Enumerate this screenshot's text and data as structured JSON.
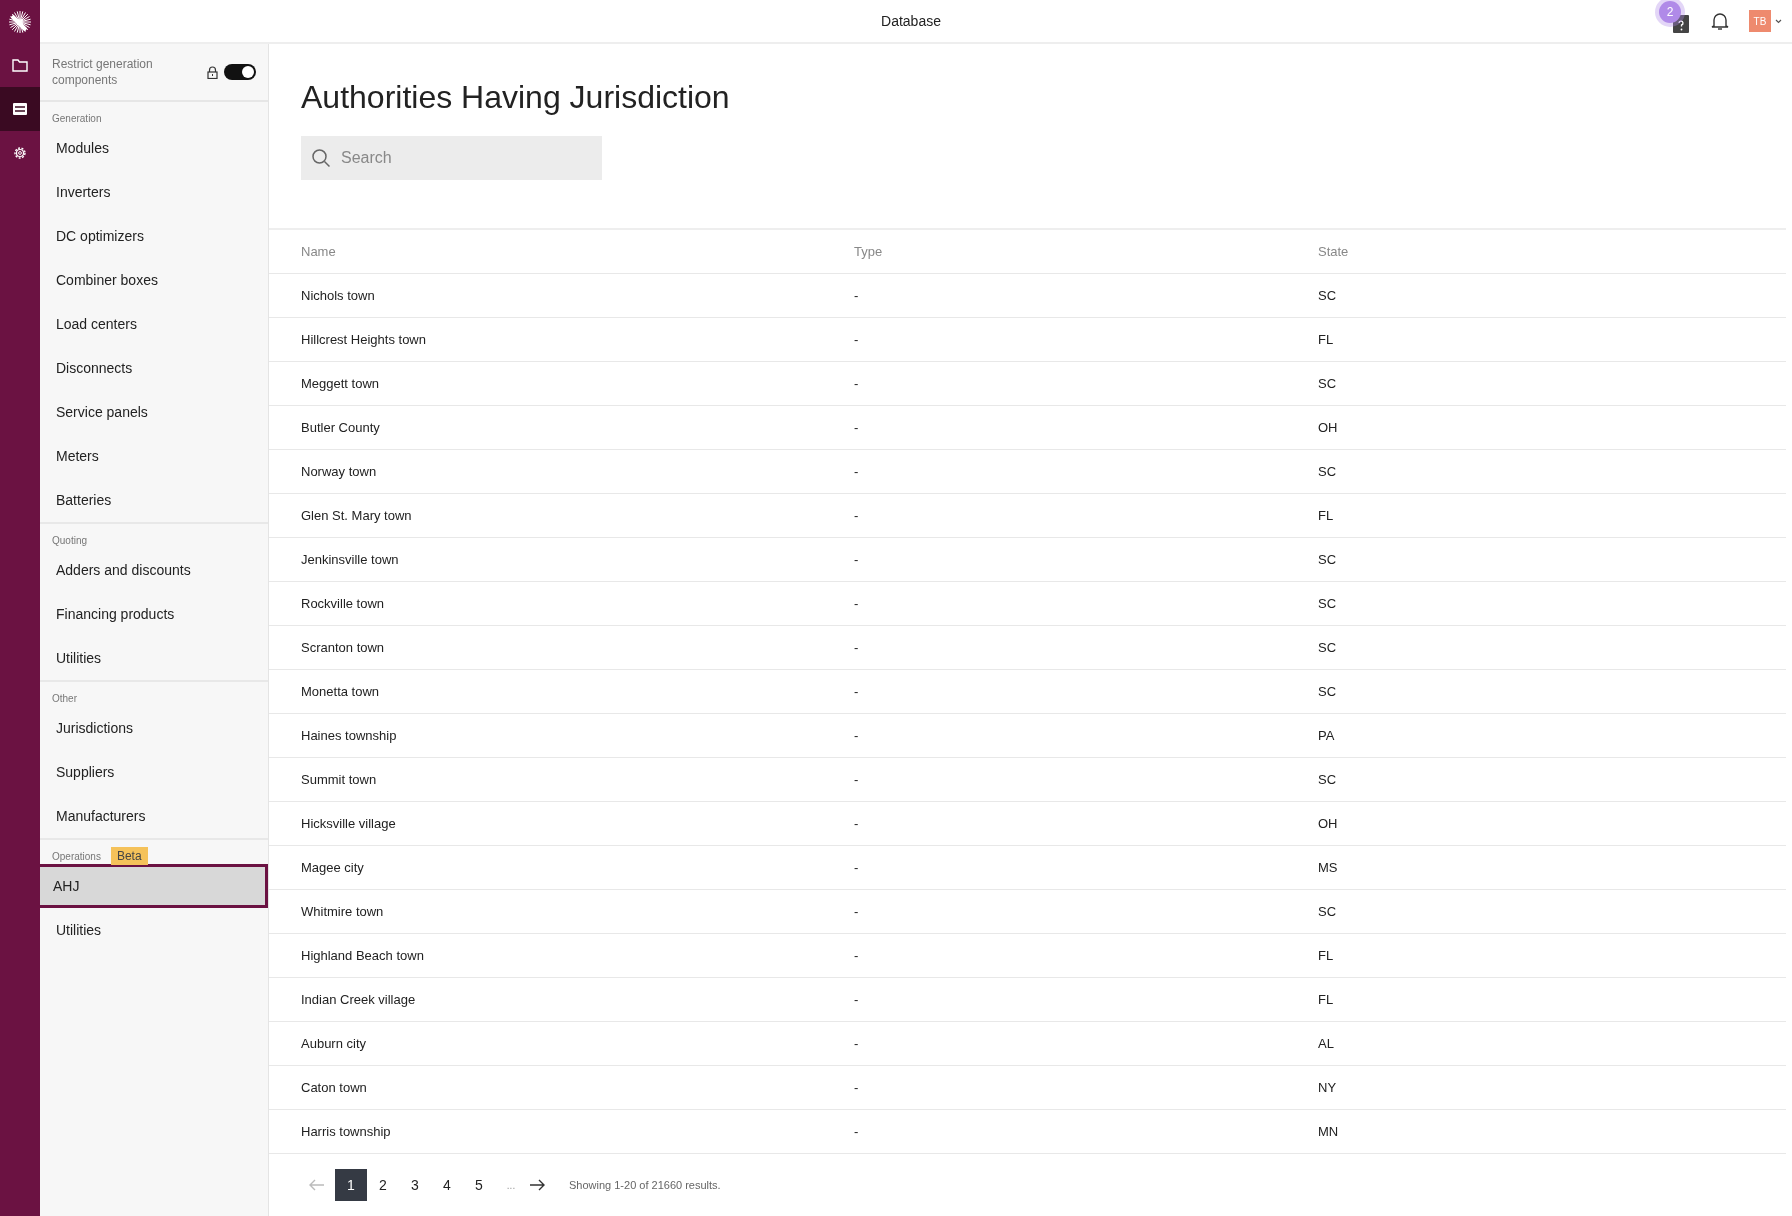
{
  "topbar": {
    "title": "Database",
    "help_badge": "2",
    "avatar": "TB"
  },
  "rail": [
    {
      "kind": "folder",
      "selected": false
    },
    {
      "kind": "list",
      "selected": true
    },
    {
      "kind": "gear",
      "selected": false
    }
  ],
  "sidebar": {
    "restrict": {
      "label": "Restrict generation components",
      "locked": true,
      "on": true
    },
    "sections": [
      {
        "label": "Generation",
        "items": [
          {
            "label": "Modules",
            "selected": false
          },
          {
            "label": "Inverters",
            "selected": false
          },
          {
            "label": "DC optimizers",
            "selected": false
          },
          {
            "label": "Combiner boxes",
            "selected": false
          },
          {
            "label": "Load centers",
            "selected": false
          },
          {
            "label": "Disconnects",
            "selected": false
          },
          {
            "label": "Service panels",
            "selected": false
          },
          {
            "label": "Meters",
            "selected": false
          },
          {
            "label": "Batteries",
            "selected": false
          }
        ]
      },
      {
        "label": "Quoting",
        "items": [
          {
            "label": "Adders and discounts",
            "selected": false
          },
          {
            "label": "Financing products",
            "selected": false
          },
          {
            "label": "Utilities",
            "selected": false
          }
        ]
      },
      {
        "label": "Other",
        "items": [
          {
            "label": "Jurisdictions",
            "selected": false
          },
          {
            "label": "Suppliers",
            "selected": false
          },
          {
            "label": "Manufacturers",
            "selected": false
          }
        ]
      },
      {
        "label": "Operations",
        "badge": "Beta",
        "items": [
          {
            "label": "AHJ",
            "selected": true
          },
          {
            "label": "Utilities",
            "selected": false
          }
        ]
      }
    ]
  },
  "page": {
    "title": "Authorities Having Jurisdiction",
    "search": {
      "placeholder": "Search"
    }
  },
  "table": {
    "columns": [
      "Name",
      "Type",
      "State"
    ],
    "rows": [
      [
        "Nichols town",
        "-",
        "SC"
      ],
      [
        "Hillcrest Heights town",
        "-",
        "FL"
      ],
      [
        "Meggett town",
        "-",
        "SC"
      ],
      [
        "Butler County",
        "-",
        "OH"
      ],
      [
        "Norway town",
        "-",
        "SC"
      ],
      [
        "Glen St. Mary town",
        "-",
        "FL"
      ],
      [
        "Jenkinsville town",
        "-",
        "SC"
      ],
      [
        "Rockville town",
        "-",
        "SC"
      ],
      [
        "Scranton town",
        "-",
        "SC"
      ],
      [
        "Monetta town",
        "-",
        "SC"
      ],
      [
        "Haines township",
        "-",
        "PA"
      ],
      [
        "Summit town",
        "-",
        "SC"
      ],
      [
        "Hicksville village",
        "-",
        "OH"
      ],
      [
        "Magee city",
        "-",
        "MS"
      ],
      [
        "Whitmire town",
        "-",
        "SC"
      ],
      [
        "Highland Beach town",
        "-",
        "FL"
      ],
      [
        "Indian Creek village",
        "-",
        "FL"
      ],
      [
        "Auburn city",
        "-",
        "AL"
      ],
      [
        "Caton town",
        "-",
        "NY"
      ],
      [
        "Harris township",
        "-",
        "MN"
      ]
    ]
  },
  "pagination": {
    "prev_disabled": true,
    "next_disabled": false,
    "pages": [
      {
        "label": "1",
        "selected": true
      },
      {
        "label": "2",
        "selected": false
      },
      {
        "label": "3",
        "selected": false
      },
      {
        "label": "4",
        "selected": false
      },
      {
        "label": "5",
        "selected": false
      }
    ],
    "ellipsis": "...",
    "summary": "Showing 1-20 of 21660 results."
  }
}
